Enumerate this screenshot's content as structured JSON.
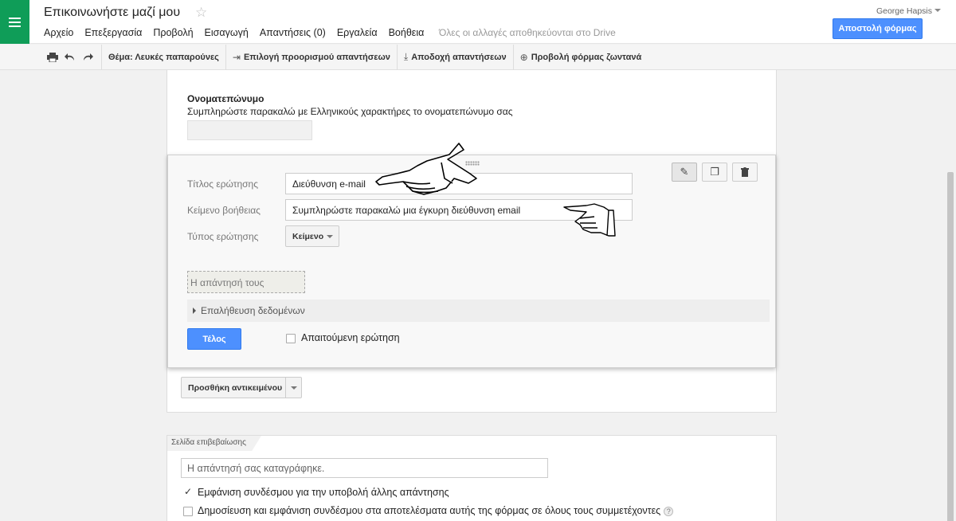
{
  "header": {
    "doc_title": "Επικοινωνήστε μαζί μου",
    "menu": [
      "Αρχείο",
      "Επεξεργασία",
      "Προβολή",
      "Εισαγωγή",
      "Απαντήσεις (0)",
      "Εργαλεία",
      "Βοήθεια"
    ],
    "save_status": "Όλες οι αλλαγές αποθηκεύονται στο Drive",
    "user_name": "George Hapsis",
    "send_button": "Αποστολή φόρμας",
    "accent_color": "#4d90fe",
    "logo_color": "#0f9d58"
  },
  "toolbar": {
    "theme": "Θέμα: Λευκές παπαρούνες",
    "choose_destination": "Επιλογή προορισμού απαντήσεων",
    "accept_responses": "Αποδοχή απαντήσεων",
    "view_live": "Προβολή φόρμας ζωντανά"
  },
  "question1": {
    "title": "Ονοματεπώνυμο",
    "help": "Συμπληρώστε παρακαλώ με Ελληνικούς χαρακτήρες το ονοματεπώνυμο σας"
  },
  "editor": {
    "label_title": "Τίτλος ερώτησης",
    "value_title": "Διεύθυνση e-mail",
    "label_help": "Κείμενο βοήθειας",
    "value_help": "Συμπληρώστε παρακαλώ μια έγκυρη διεύθυνση email",
    "label_type": "Τύπος ερώτησης",
    "value_type": "Κείμενο",
    "answer_preview": "Η απάντησή τους",
    "validation": "Επαλήθευση δεδομένων",
    "done_button": "Τέλος",
    "required_label": "Απαιτούμενη ερώτηση",
    "required_checked": false
  },
  "add_item": "Προσθήκη αντικειμένου",
  "confirmation": {
    "tab": "Σελίδα επιβεβαίωσης",
    "message_placeholder": "Η απάντησή σας καταγράφηκε.",
    "options": [
      {
        "label": "Εμφάνιση συνδέσμου για την υποβολή άλλης απάντησης",
        "checked": true
      },
      {
        "label": "Δημοσίευση και εμφάνιση συνδέσμου στα αποτελέσματα αυτής της φόρμας σε όλους τους συμμετέχοντες",
        "checked": false
      }
    ],
    "help_glyph": "?"
  }
}
